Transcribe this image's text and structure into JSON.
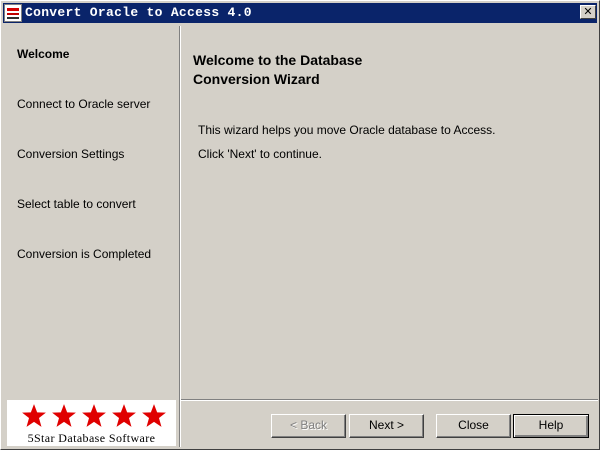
{
  "window": {
    "title": "Convert Oracle to Access 4.0"
  },
  "sidebar": {
    "items": [
      {
        "label": "Welcome",
        "active": true
      },
      {
        "label": "Connect to Oracle server",
        "active": false
      },
      {
        "label": "Conversion Settings",
        "active": false
      },
      {
        "label": "Select table to convert",
        "active": false
      },
      {
        "label": "Conversion is Completed",
        "active": false
      }
    ]
  },
  "logo": {
    "stars": 5,
    "text": "5Star Database Software",
    "star_color": "#e00000"
  },
  "main": {
    "heading_line1": "Welcome to the Database",
    "heading_line2": "Conversion Wizard",
    "paragraph1": "This wizard helps you move Oracle database to Access.",
    "paragraph2": "Click 'Next' to continue."
  },
  "buttons": {
    "back": {
      "label": "< Back",
      "enabled": false
    },
    "next": {
      "label": "Next >"
    },
    "close": {
      "label": "Close"
    },
    "help": {
      "label": "Help",
      "default": true
    }
  },
  "colors": {
    "titlebar": "#0a246a",
    "face": "#d4d0c8"
  }
}
